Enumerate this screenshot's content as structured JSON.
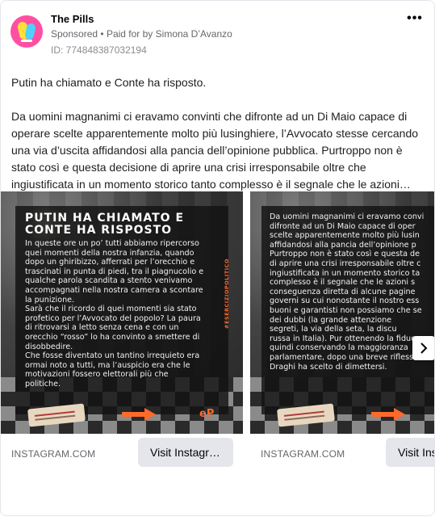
{
  "post": {
    "page_name": "The Pills",
    "sponsored": "Sponsored",
    "separator": "•",
    "paid_for_by_label": "Paid for by",
    "paid_for_by_name": "Simona D’Avanzo",
    "ad_id": "ID: 774848387032194",
    "more_label": "•••",
    "body_line1": "Putin ha chiamato e Conte ha risposto.",
    "body_para2": "Da uomini magnanimi ci eravamo convinti che difronte ad un Di Maio capace di operare scelte apparentemente molto più lusinghiere, l’Avvocato stesse cercando una via d’uscita affidandosi alla pancia dell’opinione pubblica. Purtroppo non è stato così e questa decisione di aprire una crisi irresponsabile oltre che ingiustificata in un momento storico tanto complesso è il segnale che le azioni…"
  },
  "carousel": {
    "slides": [
      {
        "title": "PUTIN HA CHIAMATO E CONTE HA RISPOSTO",
        "text": "In queste ore un po’ tutti abbiamo ripercorso\nquei momenti della nostra infanzia, quando\ndopo un ghiribizzo, afferrati per l’orecchio e\ntrascinati in punta di piedi, tra il piagnucolio e\nqualche parola scandita a stento venivamo\naccompagnati nella nostra camera a scontare\nla punizione.\nSarà che il ricordo di quei momenti sia stato\nprofetico per l’Avvocato del popolo? La paura\ndi ritrovarsi a letto senza cena e con un\norecchio “rosso” lo ha convinto a smettere di\ndisobbedire.\nChe fosse diventato un tantino irrequieto era\normai noto a tutti, ma l’auspicio era che le\nmotivazioni fossero elettorali più che\npolitiche.",
        "vertical_tag": "#ESERCIZIOPOLITICO",
        "logo": "eP",
        "domain": "INSTAGRAM.COM",
        "cta": "Visit Instagr…"
      },
      {
        "text": "Da uomini magnanimi ci eravamo convi\ndifronte ad un Di Maio capace di oper\nscelte apparentemente molto più lusin\naffidandosi alla pancia dell’opinione p\nPurtroppo non è stato così e questa de\ndi aprire una crisi irresponsabile oltre c\ningiustificata in un momento storico ta\ncomplesso è il segnale che le azioni s\nconseguenza diretta di alcune pagine\ngoverni su cui nonostante il nostro ess\nbuoni e garantisti non possiamo che se\ndei dubbi (la grande attenzione\nsegreti, la via della seta, la discu\nrussa in Italia). Pur ottenendo la fiduc\nquindi conservando la maggioranza\nparlamentare, dopo una breve riflessio\nDraghi ha scelto di dimettersi.",
        "domain": "INSTAGRAM.COM",
        "cta": "Visit Ins"
      }
    ]
  },
  "colors": {
    "accent_orange": "#ff6a2b",
    "avatar_pink": "#ff4fa3",
    "button_gray": "#e4e6eb",
    "secondary_text": "#65676b"
  },
  "icons": {
    "next": "chevron-right-icon",
    "more": "more-horizontal-icon"
  }
}
